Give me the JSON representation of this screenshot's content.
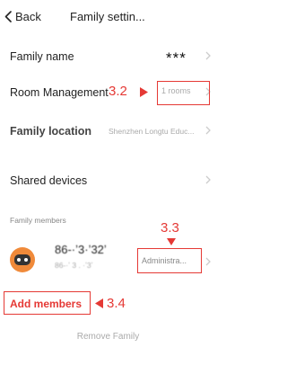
{
  "header": {
    "back_label": "Back",
    "title": "Family settin..."
  },
  "rows": {
    "family_name": {
      "label": "Family name",
      "value": "***"
    },
    "room_management": {
      "label": "Room Management",
      "value": "1 rooms"
    },
    "family_location": {
      "label": "Family location",
      "value": "Shenzhen Longtu Educ..."
    },
    "shared_devices": {
      "label": "Shared devices"
    }
  },
  "members_section": {
    "label": "Family members",
    "members": [
      {
        "name": "86-·ʼ3·ʼ32ʼ",
        "phone": "86-·ʼ 3 . ·ʼ3ʼ",
        "role": "Administra..."
      }
    ],
    "add_label": "Add members"
  },
  "footer": {
    "remove_label": "Remove Family"
  },
  "annotations": [
    {
      "text": "3.2"
    },
    {
      "text": "3.3"
    },
    {
      "text": "3.4"
    }
  ],
  "colors": {
    "accent": "#e53935",
    "avatar": "#f08a3a",
    "secondary_text": "#aaaaaa"
  }
}
